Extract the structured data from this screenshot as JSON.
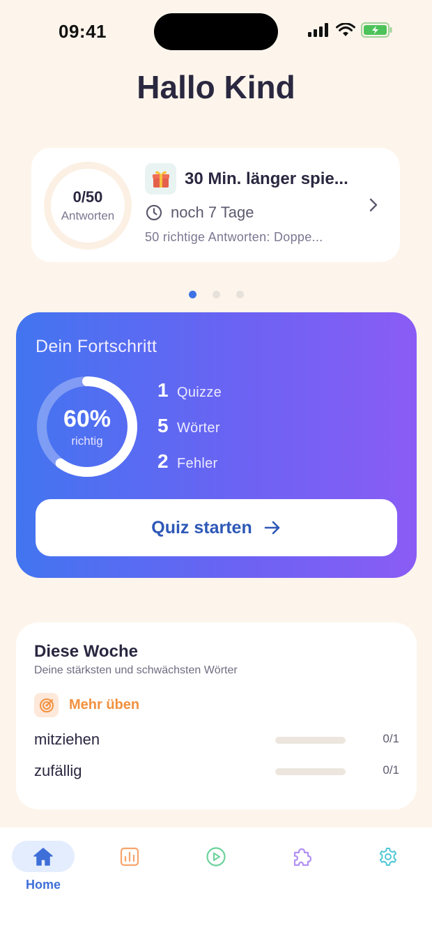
{
  "status_bar": {
    "time": "09:41",
    "icons": [
      "signal-icon",
      "wifi-icon",
      "battery-charging-icon"
    ]
  },
  "page": {
    "title": "Hallo Kind"
  },
  "reward_card": {
    "progress": {
      "count": "0/50",
      "label": "Antworten",
      "fraction": 0
    },
    "icon": "gift-icon",
    "title": "30 Min. länger spie...",
    "days_left": "noch 7 Tage",
    "description": "50 richtige Antworten: Doppe..."
  },
  "carousel": {
    "pages": 3,
    "active_index": 0
  },
  "progress_card": {
    "title": "Dein Fortschritt",
    "percent_text": "60%",
    "percent_value": 0.6,
    "percent_label": "richtig",
    "stats": [
      {
        "value": "1",
        "label": "Quizze"
      },
      {
        "value": "5",
        "label": "Wörter"
      },
      {
        "value": "2",
        "label": "Fehler"
      }
    ],
    "start_button": "Quiz starten"
  },
  "week_card": {
    "title": "Diese Woche",
    "subtitle": "Deine stärksten und schwächsten Wörter",
    "practice_label": "Mehr üben",
    "words": [
      {
        "word": "mitziehen",
        "score": "0/1",
        "fraction": 0
      },
      {
        "word": "zufällig",
        "score": "0/1",
        "fraction": 0
      }
    ]
  },
  "tab_bar": {
    "tabs": [
      {
        "label": "Home",
        "icon": "home-icon",
        "active": true
      },
      {
        "label": "",
        "icon": "stats-icon",
        "active": false
      },
      {
        "label": "",
        "icon": "play-icon",
        "active": false
      },
      {
        "label": "",
        "icon": "puzzle-icon",
        "active": false
      },
      {
        "label": "",
        "icon": "settings-icon",
        "active": false
      }
    ]
  },
  "colors": {
    "background": "#FDF5EB",
    "accent_blue": "#3E73E6",
    "gradient_start": "#4275F0",
    "gradient_end": "#8A5CF5",
    "orange": "#F2913F"
  }
}
